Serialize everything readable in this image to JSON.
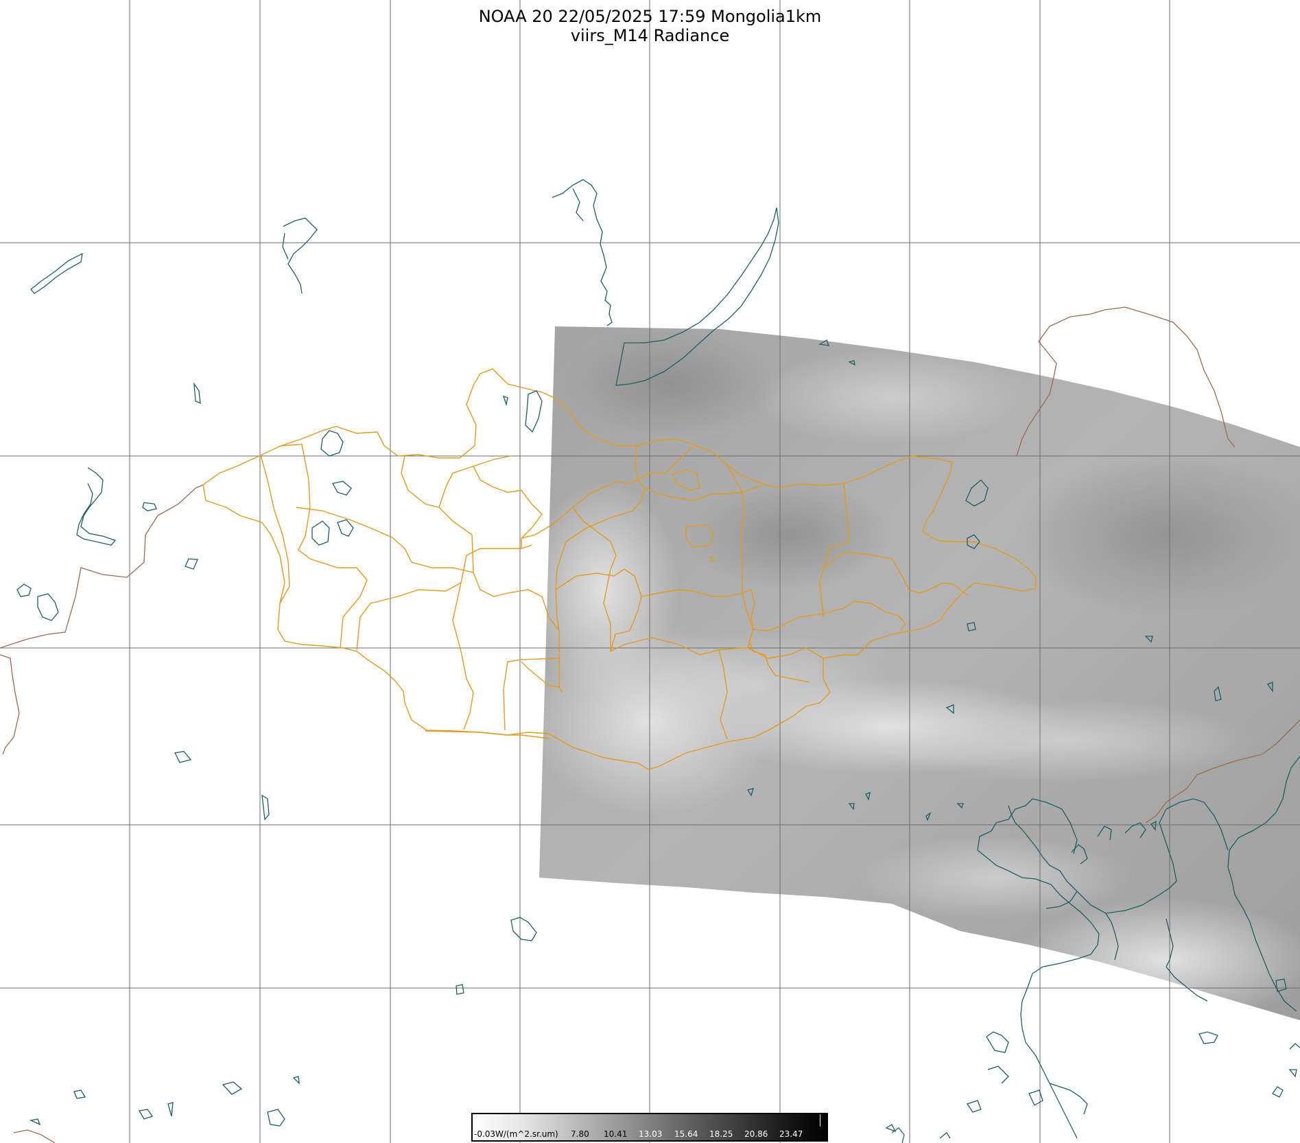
{
  "header": {
    "line1": "NOAA 20 22/05/2025 17:59 Mongolia1km",
    "line2": "viirs_M14 Radiance"
  },
  "colorbar": {
    "labels": [
      "-0.03W/(m^2.sr.um)",
      "7.80",
      "10.41",
      "13.03",
      "15.64",
      "18.25",
      "20.86",
      "23.47"
    ]
  },
  "colors": {
    "grid": "#6b6b6b",
    "coast": "#1c5f63",
    "admin_border": "#e39a1e",
    "country_border": "#9a6a50",
    "swath": "#a7a7a7"
  }
}
